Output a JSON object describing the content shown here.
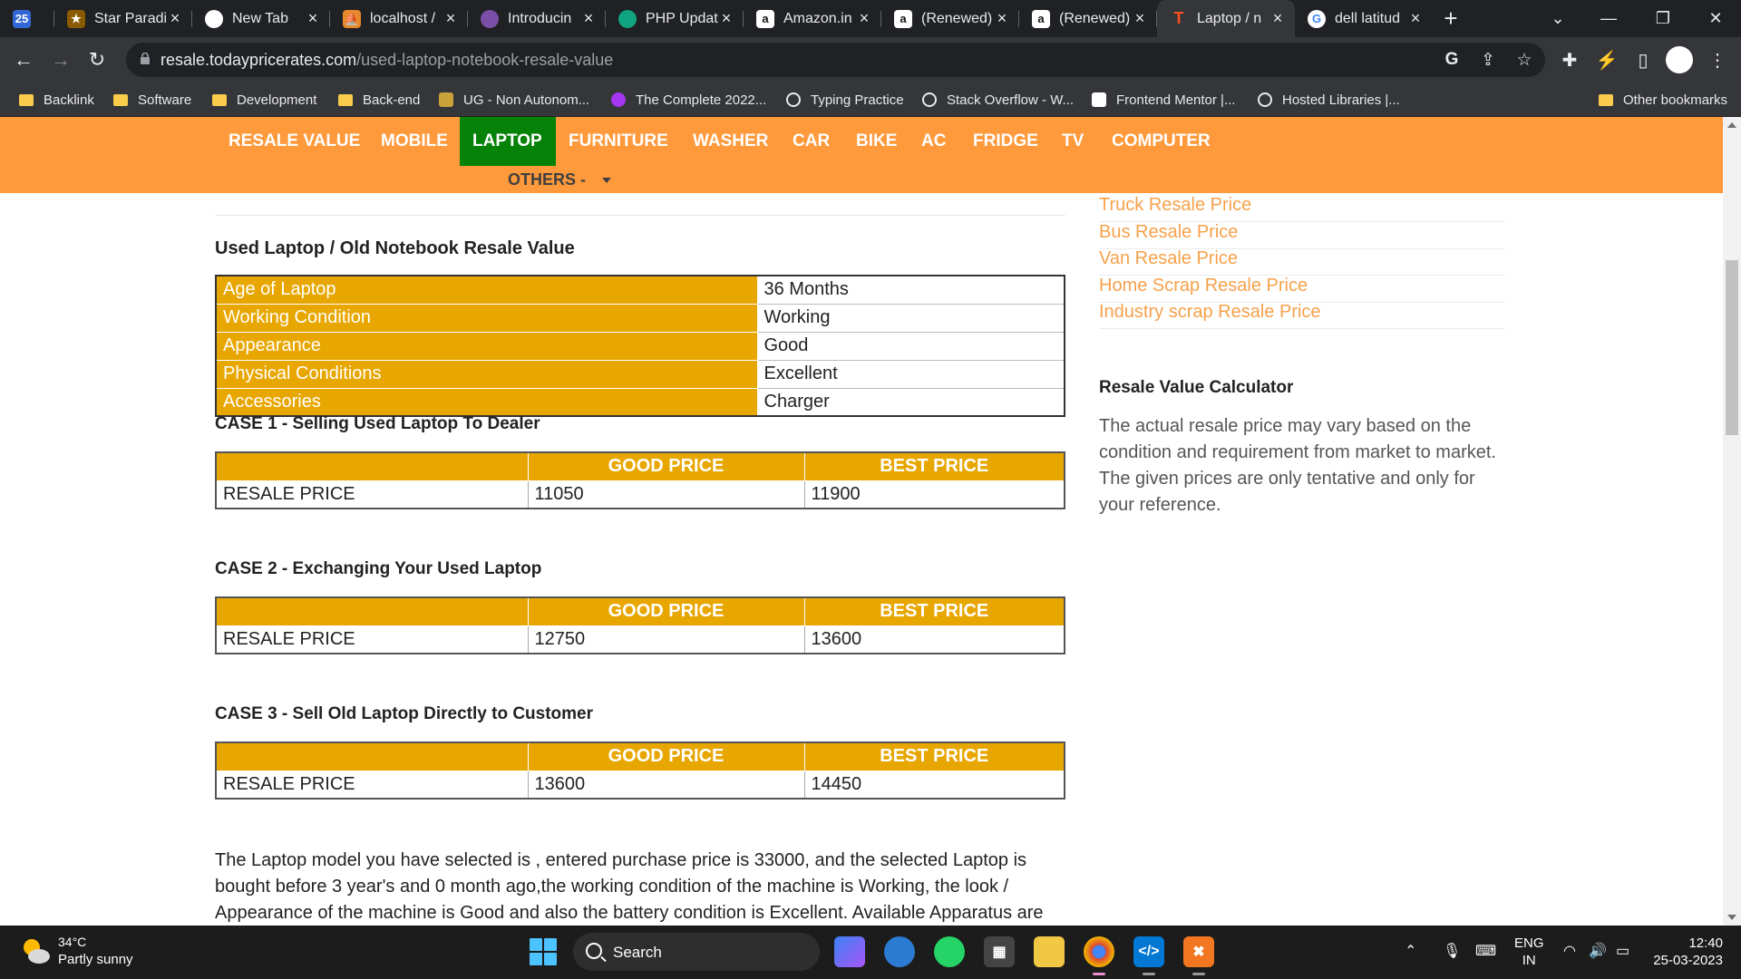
{
  "browser": {
    "tabs": [
      {
        "title": "",
        "favicon": "calendar-favicon",
        "color": "#3367d6"
      },
      {
        "title": "Star Paradi",
        "favicon": "star-favicon",
        "color": "#8a5a00"
      },
      {
        "title": "New Tab",
        "favicon": "chrome-favicon",
        "color": "#5f6368"
      },
      {
        "title": "localhost /",
        "favicon": "phpmyadmin-favicon",
        "color": "#e8872b"
      },
      {
        "title": "Introducin",
        "favicon": "openai-favicon",
        "color": "#7b4fa8"
      },
      {
        "title": "PHP Updat",
        "favicon": "chatgpt-favicon",
        "color": "#10a37f"
      },
      {
        "title": "Amazon.in",
        "favicon": "amazon-favicon",
        "color": "#ffffff"
      },
      {
        "title": "(Renewed)",
        "favicon": "amazon-favicon",
        "color": "#ffffff"
      },
      {
        "title": "(Renewed)",
        "favicon": "amazon-favicon",
        "color": "#ffffff"
      },
      {
        "title": "Laptop / n",
        "favicon": "todaypricerates-favicon",
        "color": "#f4511e",
        "active": true
      },
      {
        "title": "dell latitud",
        "favicon": "google-favicon",
        "color": "#4285f4"
      }
    ],
    "url_host": "resale.todaypricerates.com",
    "url_path": "/used-laptop-notebook-resale-value",
    "bookmarks": [
      {
        "label": "Backlink",
        "icon": "folder-icon"
      },
      {
        "label": "Software",
        "icon": "folder-icon"
      },
      {
        "label": "Development",
        "icon": "folder-icon"
      },
      {
        "label": "Back-end",
        "icon": "folder-icon"
      },
      {
        "label": "UG - Non Autonom...",
        "icon": "ug-icon"
      },
      {
        "label": "The Complete 2022...",
        "icon": "udemy-icon"
      },
      {
        "label": "Typing Practice",
        "icon": "globe-icon"
      },
      {
        "label": "Stack Overflow - W...",
        "icon": "globe-icon"
      },
      {
        "label": "Frontend Mentor |...",
        "icon": "frontendmentor-icon"
      },
      {
        "label": "Hosted Libraries |...",
        "icon": "globe-icon"
      }
    ],
    "other_bookmarks": "Other bookmarks"
  },
  "nav": {
    "items": [
      "RESALE VALUE",
      "MOBILE",
      "LAPTOP",
      "FURNITURE",
      "WASHER",
      "CAR",
      "BIKE",
      "AC",
      "FRIDGE",
      "TV",
      "COMPUTER"
    ],
    "active": "LAPTOP",
    "others": "OTHERS  -"
  },
  "main": {
    "title": "Used Laptop / Old Notebook Resale Value",
    "specs": [
      {
        "label": "Age of Laptop",
        "value": "36 Months"
      },
      {
        "label": "Working Condition",
        "value": "Working"
      },
      {
        "label": "Appearance",
        "value": "Good"
      },
      {
        "label": "Physical Conditions",
        "value": "Excellent"
      },
      {
        "label": "Accessories",
        "value": "Charger"
      }
    ],
    "cases": [
      {
        "title": "CASE 1 - Selling Used Laptop To Dealer",
        "good_header": "GOOD PRICE",
        "best_header": "BEST PRICE",
        "row_label": "RESALE PRICE",
        "good": "11050",
        "best": "11900"
      },
      {
        "title": "CASE 2 - Exchanging Your Used Laptop",
        "good_header": "GOOD PRICE",
        "best_header": "BEST PRICE",
        "row_label": "RESALE PRICE",
        "good": "12750",
        "best": "13600"
      },
      {
        "title": "CASE 3 - Sell Old Laptop Directly to Customer",
        "good_header": "GOOD PRICE",
        "best_header": "BEST PRICE",
        "row_label": "RESALE PRICE",
        "good": "13600",
        "best": "14450"
      }
    ],
    "paragraph": "The Laptop model you have selected is , entered purchase price is 33000, and the selected Laptop is bought before 3 year's and 0 month ago,the working condition of the machine is Working, the look / Appearance of the machine is Good and also the battery condition is Excellent. Available Apparatus are"
  },
  "sidebar": {
    "links": [
      "Truck Resale Price",
      "Bus Resale Price",
      "Van Resale Price",
      "Home Scrap Resale Price",
      "Industry scrap Resale Price"
    ],
    "calc_title": "Resale Value Calculator",
    "calc_text": "The actual resale price may vary based on the condition and requirement from market to market. The given prices are only tentative and only for your reference."
  },
  "taskbar": {
    "temp": "34°C",
    "weather": "Partly sunny",
    "search": "Search",
    "lang_top": "ENG",
    "lang_bottom": "IN",
    "time": "12:40",
    "date": "25-03-2023"
  },
  "colors": {
    "nav_bg": "#fe9a3c",
    "nav_active": "#068209",
    "table_header": "#e8a700",
    "link": "#f6a14b"
  }
}
